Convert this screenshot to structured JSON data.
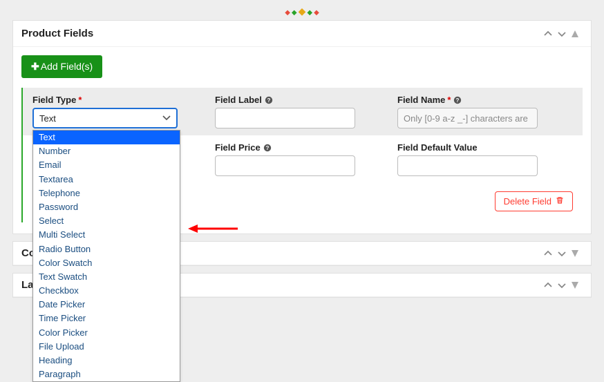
{
  "panels": {
    "product_fields": {
      "title": "Product Fields"
    },
    "collapsed1": {
      "title": "Co"
    },
    "collapsed2": {
      "title": "La"
    }
  },
  "buttons": {
    "add_fields": "Add Field(s)",
    "delete_field": "Delete Field"
  },
  "labels": {
    "field_type": "Field Type",
    "field_label": "Field Label",
    "field_name": "Field Name",
    "field_price": "Field Price",
    "field_default": "Field Default Value"
  },
  "placeholders": {
    "field_name": "Only [0-9 a-z _-] characters are"
  },
  "select": {
    "value": "Text",
    "options": [
      "Text",
      "Number",
      "Email",
      "Textarea",
      "Telephone",
      "Password",
      "Select",
      "Multi Select",
      "Radio Button",
      "Color Swatch",
      "Text Swatch",
      "Checkbox",
      "Date Picker",
      "Time Picker",
      "Color Picker",
      "File Upload",
      "Heading",
      "Paragraph"
    ]
  }
}
